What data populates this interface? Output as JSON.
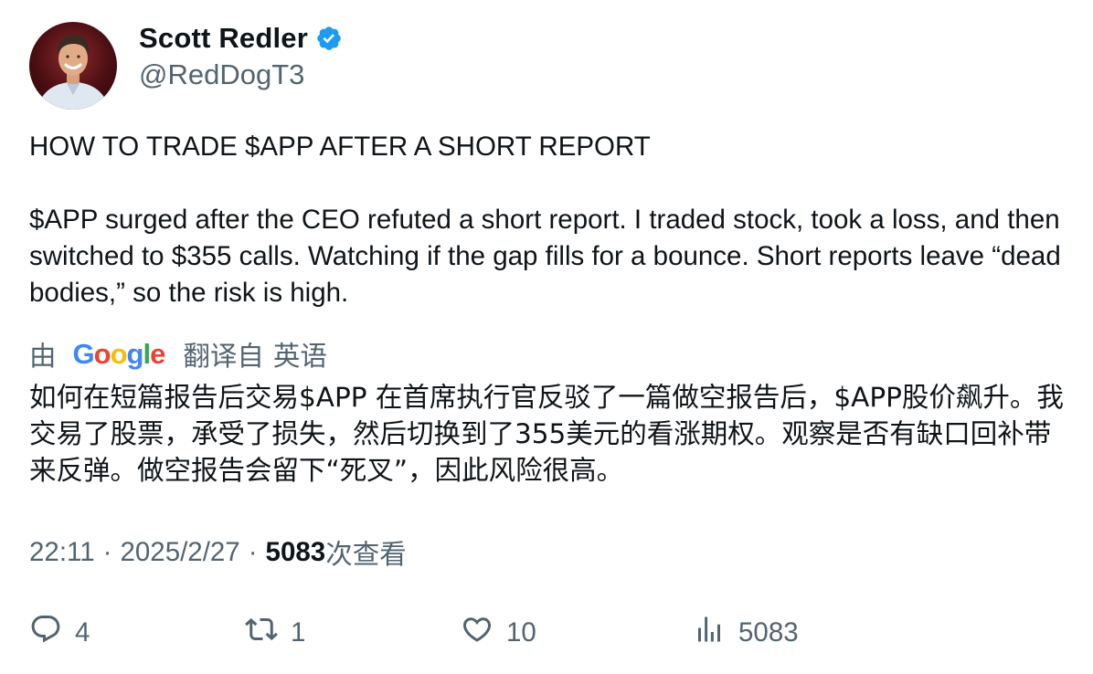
{
  "author": {
    "display_name": "Scott Redler",
    "handle": "@RedDogT3",
    "verified": true
  },
  "tweet": {
    "text": "HOW TO TRADE $APP AFTER A SHORT REPORT\n\n$APP surged after the CEO refuted a short report. I traded stock, took a loss, and then switched to $355 calls. Watching if the gap fills for a bounce. Short reports leave “dead bodies,” so the risk is high."
  },
  "translation": {
    "by_label": "由",
    "provider_letters": [
      "G",
      "o",
      "o",
      "g",
      "l",
      "e"
    ],
    "provider_colors": [
      "#4285F4",
      "#EA4335",
      "#FBBC05",
      "#4285F4",
      "#34A853",
      "#EA4335"
    ],
    "translated_from_label": "翻译自",
    "source_language": "英语",
    "text": "如何在短篇报告后交易$APP 在首席执行官反驳了一篇做空报告后，$APP股价飙升。我交易了股票，承受了损失，然后切换到了355美元的看涨期权。观察是否有缺口回补带来反弹。做空报告会留下“死叉”，因此风险很高。"
  },
  "meta": {
    "time": "22:11",
    "separator": "·",
    "date": "2025/2/27",
    "views_count": "5083",
    "views_label": "次查看"
  },
  "actions": {
    "reply_count": "4",
    "retweet_count": "1",
    "like_count": "10",
    "views_count": "5083"
  },
  "colors": {
    "text_primary": "#0f1419",
    "text_secondary": "#536471",
    "verified_blue": "#1d9bf0"
  },
  "icons": {
    "verified": "verified-badge-icon",
    "reply": "reply-icon",
    "retweet": "retweet-icon",
    "like": "heart-icon",
    "views": "views-chart-icon"
  }
}
